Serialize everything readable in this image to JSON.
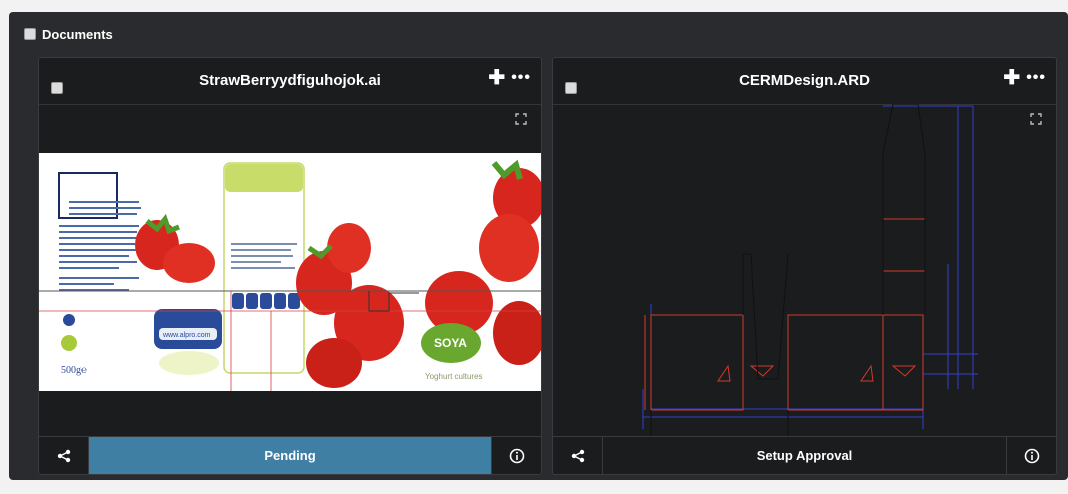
{
  "section": {
    "title": "Documents"
  },
  "panels": [
    {
      "title": "StrawBerryydfiguhojok.ai",
      "status": "Pending",
      "artwork": {
        "brand": "SOYA",
        "weight": "500g℮",
        "tagline": "Yoghurt cultures",
        "web": "www.alpro.com"
      }
    },
    {
      "title": "CERMDesign.ARD",
      "status": "Setup Approval"
    }
  ],
  "colors": {
    "pending": "#3f7fa3",
    "cut_line": "#d23a2a",
    "dimension_line": "#2f3fd0",
    "fold_line": "#111111"
  },
  "icons": [
    "plus-icon",
    "more-icon",
    "expand-icon",
    "share-icon",
    "info-icon",
    "checkbox-icon"
  ]
}
